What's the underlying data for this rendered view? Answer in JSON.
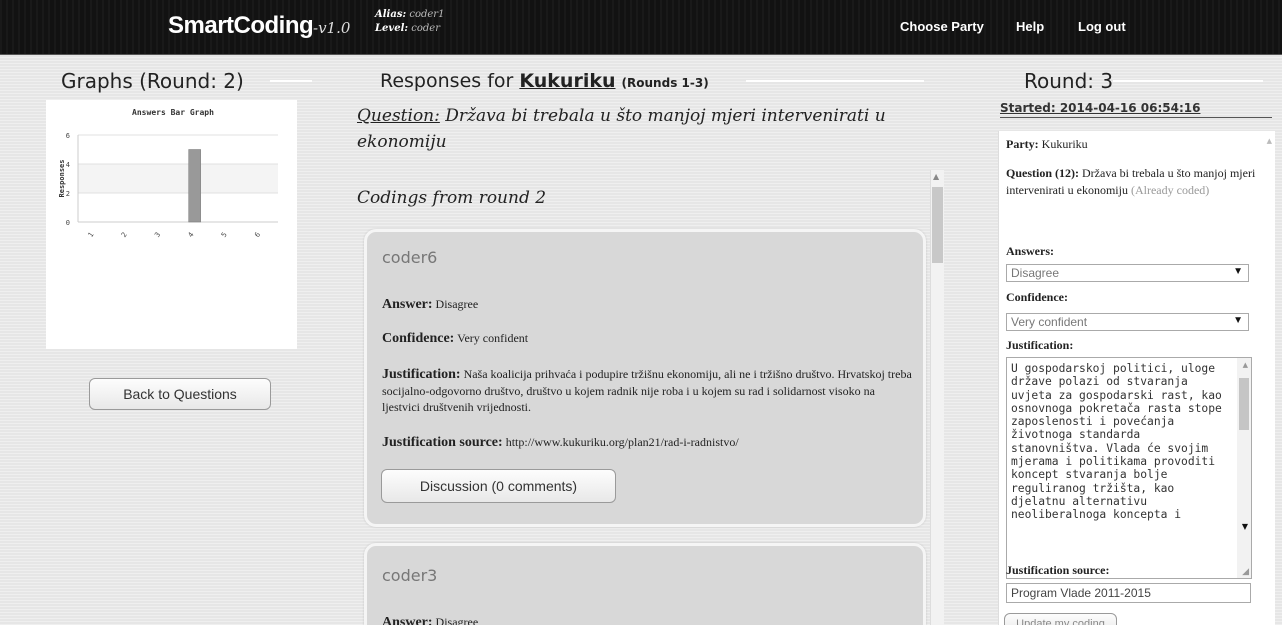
{
  "topbar": {
    "brand": "SmartCoding",
    "version": "-v1.0",
    "alias_label": "Alias:",
    "alias_value": "coder1",
    "level_label": "Level:",
    "level_value": "coder",
    "nav": [
      "Choose Party",
      "Help",
      "Log out"
    ]
  },
  "left": {
    "heading": "Graphs (Round: 2)",
    "back_button": "Back to Questions"
  },
  "chart_data": {
    "type": "bar",
    "title": "Answers Bar Graph",
    "ylabel": "Responses",
    "xlabel": "",
    "categories": [
      "1",
      "2",
      "3",
      "4",
      "5",
      "6"
    ],
    "values": [
      0,
      0,
      0,
      5,
      0,
      0
    ],
    "ylim": [
      0,
      6
    ],
    "yticks": [
      "0",
      "2",
      "4",
      "6"
    ],
    "bar_color": "#999999",
    "grid": true
  },
  "middle": {
    "heading_prefix": "Responses for",
    "party": "Kukuriku",
    "rounds": "(Rounds 1-3)",
    "question_label": "Question:",
    "question_text": "Država bi trebala u što manjoj mjeri intervenirati u ekonomiju",
    "codings_title": "Codings from round 2",
    "cards": [
      {
        "coder": "coder6",
        "answer_label": "Answer:",
        "answer": "Disagree",
        "confidence_label": "Confidence:",
        "confidence": "Very confident",
        "justification_label": "Justification:",
        "justification": "Naša koalicija prihvaća i podupire tržišnu ekonomiju, ali ne i tržišno društvo. Hrvatskoj treba socijalno-odgovorno društvo, društvo u kojem radnik nije roba i u kojem su rad i solidarnost visoko na ljestvici društvenih vrijednosti.",
        "source_label": "Justification source:",
        "source": "http://www.kukuriku.org/plan21/rad-i-radnistvo/",
        "discussion": "Discussion (0 comments)"
      },
      {
        "coder": "coder3",
        "answer_label": "Answer:",
        "answer": "Disagree"
      }
    ]
  },
  "right": {
    "heading": "Round: 3",
    "started": "Started: 2014-04-16 06:54:16",
    "party_label": "Party:",
    "party": "Kukuriku",
    "question_label": "Question (12):",
    "question_text": "Država bi trebala u što manjoj mjeri intervenirati u ekonomiju",
    "already_coded": "(Already coded)",
    "answers_label": "Answers:",
    "answers_value": "Disagree",
    "confidence_label": "Confidence:",
    "confidence_value": "Very confident",
    "justification_label": "Justification:",
    "justification_text": "U gospodarskoj politici, uloge države polazi od stvaranja uvjeta za gospodarski rast, kao osnovnoga pokretača rasta stope zaposlenosti i povećanja životnoga standarda stanovništva. Vlada će svojim mjerama i politikama provoditi koncept stvaranja bolje reguliranog tržišta, kao djelatnu alternativu neoliberalnoga koncepta i",
    "source_label": "Justification source:",
    "source_value": "Program Vlade 2011-2015",
    "update_button": "Update my coding"
  }
}
